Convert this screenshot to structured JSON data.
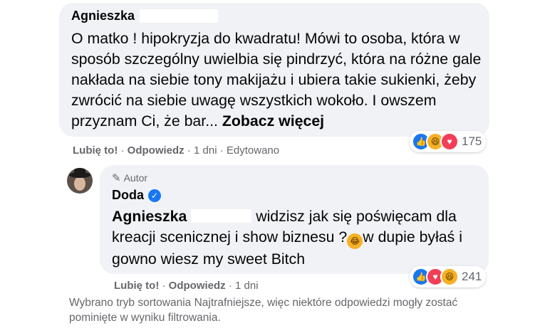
{
  "comment1": {
    "author": "Agnieszka",
    "text": "O matko ! hipokryzja do kwadratu! Mówi to osoba, która w sposób szczególny uwielbia się pindrzyć, która na różne gale nakłada na siebie tony makijażu i ubiera takie sukienki, żeby zwrócić na siebie uwagę wszystkich wokoło. I owszem przyznam Ci, że bar...",
    "see_more": "Zobacz więcej",
    "reactions": {
      "icons": [
        "like-icon",
        "haha-icon",
        "love-icon"
      ],
      "count": "175"
    },
    "actions": {
      "like": "Lubię to!",
      "reply": "Odpowiedz",
      "time": "1 dni",
      "edited": "Edytowano",
      "sep": "·"
    }
  },
  "comment2": {
    "badge": "Autor",
    "author": "Doda",
    "mention": "Agnieszka",
    "text_part1": "widzisz jak się poświęcam dla kreacji scenicznej i show biznesu ?",
    "emoji": "😂",
    "text_part2": "w dupie byłaś i gowno wiesz my sweet Bitch",
    "reactions": {
      "icons": [
        "like-icon",
        "love-icon",
        "haha-icon"
      ],
      "count": "241"
    },
    "actions": {
      "like": "Lubię to!",
      "reply": "Odpowiedz",
      "time": "1 dni",
      "sep": "·"
    }
  },
  "notice": "Wybrano tryb sortowania Najtrafniejsze, więc niektóre odpowiedzi mogły zostać pominięte w wyniku filtrowania.",
  "colors": {
    "bubble": "#f0f2f5",
    "meta": "#65676b",
    "like": "#1877f2",
    "love": "#f33e58",
    "haha": "#f7b125"
  }
}
